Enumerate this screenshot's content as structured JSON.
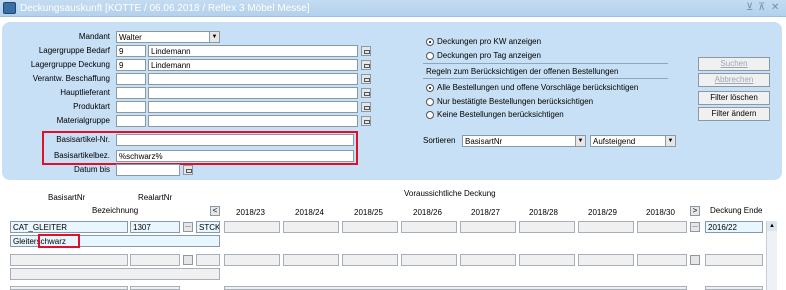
{
  "window": {
    "title": "Deckungsauskunft  [KOTTE / 06.06.2018 / Reflex 3 Möbel Messe]",
    "controls": [
      "⊻",
      "⊼",
      "✕"
    ]
  },
  "form": {
    "mandant": {
      "label": "Mandant",
      "value": "Walter"
    },
    "lagergruppe_bedarf": {
      "label": "Lagergruppe Bedarf",
      "code": "9",
      "name": "Lindemann"
    },
    "lagergruppe_deckung": {
      "label": "Lagergruppe Deckung",
      "code": "9",
      "name": "Lindemann"
    },
    "verantw_beschaffung": {
      "label": "Verantw. Beschaffung",
      "code": "",
      "name": ""
    },
    "hauptlieferant": {
      "label": "Hauptlieferant",
      "code": "",
      "name": ""
    },
    "produktart": {
      "label": "Produktart",
      "code": "",
      "name": ""
    },
    "materialgruppe": {
      "label": "Materialgruppe",
      "code": "",
      "name": ""
    },
    "basisartikel_nr": {
      "label": "Basisartikel-Nr.",
      "value": ""
    },
    "basisartikel_bez": {
      "label": "Basisartikelbez.",
      "value": "%schwarz%"
    },
    "datum_bis": {
      "label": "Datum bis",
      "value": ""
    }
  },
  "options": {
    "deckung_kw": "Deckungen pro KW anzeigen",
    "deckung_tag": "Deckungen pro Tag anzeigen",
    "regeln_title": "Regeln zum Berücksichtigen der offenen Bestellungen",
    "rule_all": "Alle Bestellungen und offene Vorschläge berücksichtigen",
    "rule_confirmed": "Nur bestätigte Bestellungen berücksichtigen",
    "rule_none": "Keine Bestellungen berücksichtigen",
    "sortieren_label": "Sortieren",
    "sort_field": "BasisartNr",
    "sort_order": "Aufsteigend"
  },
  "buttons": {
    "suchen": "Suchen",
    "abbrechen": "Abbrechen",
    "filter_loeschen": "Filter löschen",
    "filter_aendern": "Filter ändern"
  },
  "grid": {
    "hdr_basisartnr": "BasisartNr",
    "hdr_realartnr": "RealartNr",
    "hdr_bezeichnung": "Bezeichnung",
    "hdr_voraussichtliche": "Voraussichtliche Deckung",
    "prev": "<",
    "next": ">",
    "years": [
      "2018/23",
      "2018/24",
      "2018/25",
      "2018/26",
      "2018/27",
      "2018/28",
      "2018/29",
      "2018/30"
    ],
    "hdr_deckung_ende": "Deckung Ende",
    "row1": {
      "basisartnr": "CAT_GLEITER",
      "realartnr": "1307",
      "einheit": "STCK",
      "deckung_ende": "2016/22",
      "bezeichnung_a": "Gleiter",
      "bezeichnung_b": "schwarz"
    }
  }
}
